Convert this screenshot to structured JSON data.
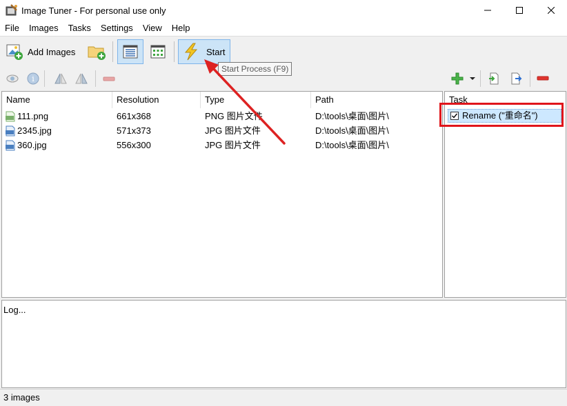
{
  "window": {
    "title": "Image Tuner - For personal use only"
  },
  "menu": [
    "File",
    "Images",
    "Tasks",
    "Settings",
    "View",
    "Help"
  ],
  "toolbar": {
    "add_images_label": "Add Images",
    "start_label": "Start",
    "tooltip": "Start Process (F9)"
  },
  "file_list": {
    "columns": [
      "Name",
      "Resolution",
      "Type",
      "Path"
    ],
    "rows": [
      {
        "name": "111.png",
        "resolution": "661x368",
        "type": "PNG 图片文件",
        "path": "D:\\tools\\桌面\\图片\\",
        "icon": "png-file-icon"
      },
      {
        "name": "2345.jpg",
        "resolution": "571x373",
        "type": "JPG 图片文件",
        "path": "D:\\tools\\桌面\\图片\\",
        "icon": "jpg-file-icon"
      },
      {
        "name": "360.jpg",
        "resolution": "556x300",
        "type": "JPG 图片文件",
        "path": "D:\\tools\\桌面\\图片\\",
        "icon": "jpg-file-icon"
      }
    ]
  },
  "task_panel": {
    "header": "Task",
    "tasks": [
      {
        "label": "Rename (\"重命名\")",
        "checked": true
      }
    ]
  },
  "log": {
    "text": "Log..."
  },
  "status": {
    "text": "3 images"
  },
  "colors": {
    "highlight_box": "#e0151b",
    "arrow": "#dd2222",
    "pressed_bg": "#cce4f7",
    "selected_row": "#cde8ff"
  }
}
